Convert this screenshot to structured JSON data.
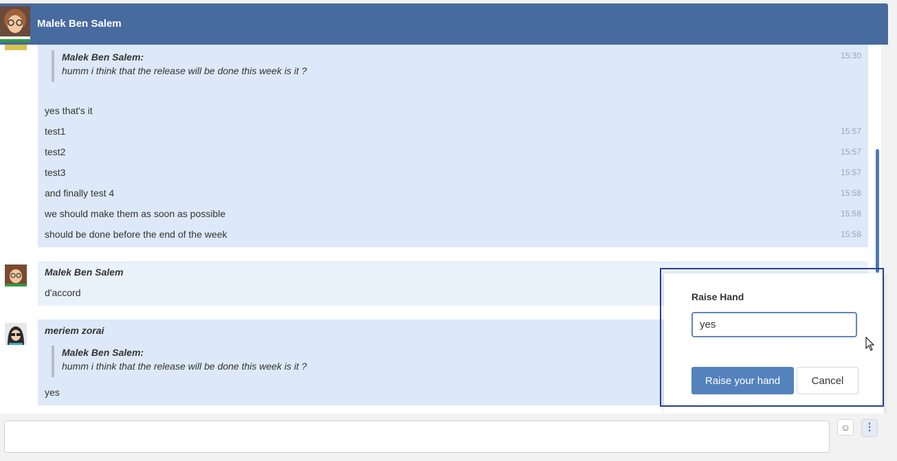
{
  "header": {
    "contact_name": "Malek Ben Salem"
  },
  "thread": {
    "group1": {
      "quote_author": "Malek Ben Salem:",
      "quote_text": "humm i think that the release will be done this week is it ?",
      "quote_time": "15:30",
      "lines": [
        {
          "text": "yes that's it",
          "time": ""
        },
        {
          "text": "test1",
          "time": "15:57"
        },
        {
          "text": "test2",
          "time": "15:57"
        },
        {
          "text": "test3",
          "time": "15:57"
        },
        {
          "text": "and finally test 4",
          "time": "15:58"
        },
        {
          "text": "we should make them as soon as possible",
          "time": "15:58"
        },
        {
          "text": "should be done before the end of the week",
          "time": "15:58"
        }
      ]
    },
    "group2": {
      "author": "Malek Ben Salem",
      "text": "d'accord"
    },
    "group3": {
      "author": "meriem zorai",
      "quote_author": "Malek Ben Salem:",
      "quote_text": "humm i think that the release will be done this week is it ?",
      "text": "yes"
    }
  },
  "raise_hand_popup": {
    "title": "Raise Hand",
    "input_value": "yes",
    "primary_label": "Raise your hand",
    "cancel_label": "Cancel"
  },
  "composer": {
    "placeholder": "",
    "emoji_icon": "smiley-icon",
    "more_icon": "vertical-ellipsis-icon",
    "more_glyph": "⋮",
    "emoji_glyph": "☺"
  },
  "colors": {
    "header_bg": "#476a9f",
    "bubble_bg": "#dde9f8",
    "accent": "#5482bd"
  }
}
